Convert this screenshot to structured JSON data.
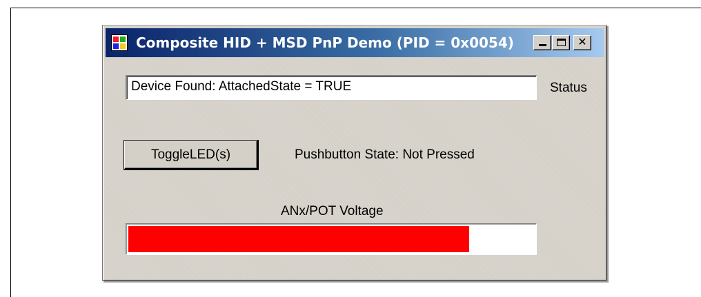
{
  "window": {
    "title": "Composite HID + MSD PnP Demo (PID = 0x0054)",
    "min_glyph": "_",
    "max_glyph": "□",
    "close_glyph": "✕"
  },
  "status": {
    "value": "Device Found: AttachedState = TRUE",
    "label": "Status"
  },
  "controls": {
    "toggle_label": "ToggleLED(s)",
    "pushbutton_state": "Pushbutton State: Not Pressed"
  },
  "voltage": {
    "label": "ANx/POT Voltage",
    "level": 0.84,
    "bar_color": "#ff0000"
  }
}
